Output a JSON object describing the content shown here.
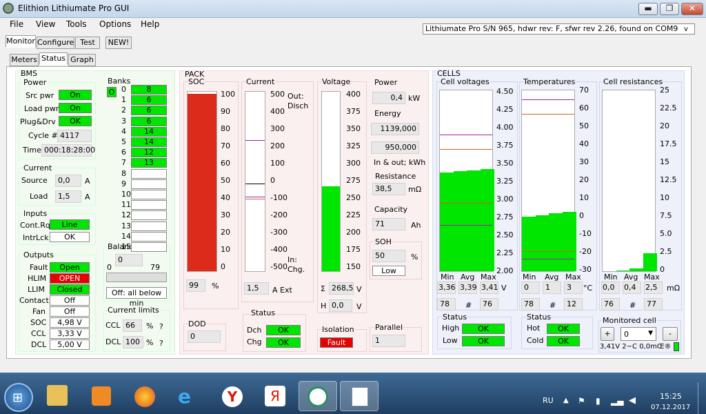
{
  "window": {
    "title": "Elithion Lithiumate Pro GUI",
    "minimize": "▬",
    "maximize": "❐",
    "close": "✕"
  },
  "menu": [
    "File",
    "View",
    "Tools",
    "Options",
    "Help"
  ],
  "device_info": "Lithiumate Pro S/N 965, hdwr rev: F, sfwr rev 2.26, found on COM9",
  "device_info_arrow": "v",
  "main_tabs": [
    "Monitor",
    "Configure",
    "Test",
    "NEW!"
  ],
  "sub_tabs": [
    "Meters",
    "Status",
    "Graph"
  ],
  "colors": {
    "green": "#00e600",
    "red": "#e60000",
    "bms_bg": "#f3fbf1",
    "pack_bg": "#fbf0f0",
    "cells_bg": "#eef0fa"
  },
  "bms": {
    "title": "BMS",
    "power": {
      "title": "Power",
      "src_label": "Src pwr",
      "src": "On",
      "load_label": "Load pwr",
      "load": "On",
      "plug_label": "Plug&Drv",
      "plug": "OK",
      "cycle_label": "Cycle #",
      "cycle": "4117",
      "time_label": "Time",
      "time": "000:18:28:00"
    },
    "current": {
      "title": "Current",
      "source_label": "Source",
      "source": "0,0",
      "source_unit": "A",
      "load_label": "Load",
      "load": "1,5",
      "load_unit": "A"
    },
    "inputs": {
      "title": "Inputs",
      "contrq_label": "Cont.Rq",
      "contrq": "Line",
      "intrlck_label": "IntrLck",
      "intrlck": "OK"
    },
    "outputs": {
      "title": "Outputs",
      "fault_label": "Fault",
      "fault": "Open",
      "hlim_label": "HLIM",
      "hlim": "OPEN",
      "llim_label": "LLIM",
      "llim": "Closed",
      "contact_label": "Contact.",
      "contact": "Off",
      "fan_label": "Fan",
      "fan": "Off",
      "soc_label": "SOC",
      "soc": "4,98 V",
      "ccl_label": "CCL",
      "ccl": "3,33 V",
      "dcl_label": "DCL",
      "dcl": "5,00 V"
    },
    "banks": {
      "title": "Banks",
      "selector": "O",
      "rows": [
        {
          "n": "0",
          "v": "8"
        },
        {
          "n": "1",
          "v": "6"
        },
        {
          "n": "2",
          "v": "6"
        },
        {
          "n": "3",
          "v": "6"
        },
        {
          "n": "4",
          "v": "14"
        },
        {
          "n": "5",
          "v": "14"
        },
        {
          "n": "6",
          "v": "12"
        },
        {
          "n": "7",
          "v": "13"
        },
        {
          "n": "8",
          "v": ""
        },
        {
          "n": "9",
          "v": ""
        },
        {
          "n": "10",
          "v": ""
        },
        {
          "n": "11",
          "v": ""
        },
        {
          "n": "12",
          "v": ""
        },
        {
          "n": "13",
          "v": ""
        },
        {
          "n": "14",
          "v": ""
        },
        {
          "n": "15",
          "v": ""
        }
      ]
    },
    "balance": {
      "title": "Balance loads",
      "value": "0",
      "min": "0",
      "max": "79",
      "progress": 0,
      "status": "Off: all below min"
    },
    "current_limits": {
      "title": "Current limits",
      "ccl_label": "CCL",
      "ccl": "66",
      "ccl_unit": "%",
      "ccl_q": "?",
      "dcl_label": "DCL",
      "dcl": "100",
      "dcl_unit": "%",
      "dcl_q": "?"
    }
  },
  "pack": {
    "title": "PACK",
    "soc": {
      "title": "SOC",
      "ticks": [
        "100",
        "90",
        "80",
        "70",
        "60",
        "50",
        "40",
        "30",
        "20",
        "10",
        "0"
      ],
      "level_percent": 99,
      "value": "99",
      "unit": "%"
    },
    "current": {
      "title": "Current",
      "ticks": [
        "500",
        "400",
        "300",
        "200",
        "100",
        "0",
        "-100",
        "-200",
        "-300",
        "-400",
        "-500"
      ],
      "out_label": "Out:\nDisch",
      "in_label": "In:\nChg.",
      "value": "1,5",
      "unit": "A Ext"
    },
    "voltage": {
      "title": "Voltage",
      "ticks": [
        "400",
        "375",
        "350",
        "325",
        "300",
        "275",
        "250",
        "225",
        "200",
        "175",
        "150"
      ],
      "level_value": 268.5,
      "range": [
        150,
        400
      ],
      "sum_label": "Σ",
      "sum": "268,5",
      "sum_unit": "V",
      "h_label": "H",
      "h": "0,0",
      "h_unit": "V"
    },
    "power": {
      "title": "Power",
      "value": "0,4",
      "unit": "kW"
    },
    "energy": {
      "title": "Energy",
      "in": "1139,000",
      "out": "950,000",
      "caption": "In & out; kWh"
    },
    "resistance": {
      "title": "Resistance",
      "value": "38,5",
      "unit": "mΩ"
    },
    "capacity": {
      "title": "Capacity",
      "value": "71",
      "unit": "Ah"
    },
    "soh": {
      "title": "SOH",
      "value": "50",
      "unit": "%",
      "status": "Low"
    },
    "dod": {
      "title": "DOD",
      "value": "0"
    },
    "status": {
      "title": "Status",
      "dch_label": "Dch",
      "dch": "OK",
      "chg_label": "Chg",
      "chg": "OK"
    },
    "isolation": {
      "title": "Isolation",
      "value": "Fault"
    },
    "parallel": {
      "title": "Parallel",
      "value": "1"
    }
  },
  "cells": {
    "title": "CELLS",
    "voltages": {
      "title": "Cell voltages",
      "ticks": [
        "4.50",
        "4.25",
        "4.00",
        "3.75",
        "3.50",
        "3.25",
        "3.00",
        "2.75",
        "2.50",
        "2.25",
        "2.00"
      ],
      "range": [
        2.0,
        4.5
      ],
      "bars": [
        3.36,
        3.38,
        3.39,
        3.41
      ],
      "min_label": "Min",
      "avg_label": "Avg",
      "max_label": "Max",
      "min": "3,36",
      "avg": "3,39",
      "max": "3,41",
      "unit": "V",
      "min_cell": "78",
      "hash": "#",
      "max_cell": "76"
    },
    "temperatures": {
      "title": "Temperatures",
      "ticks": [
        "70",
        "60",
        "50",
        "40",
        "30",
        "20",
        "10",
        "0",
        "-10",
        "-20",
        "-30"
      ],
      "range": [
        -30,
        70
      ],
      "bars": [
        0,
        1,
        2,
        3
      ],
      "min_label": "Min",
      "avg_label": "Avg",
      "max_label": "Max",
      "min": "0",
      "avg": "1",
      "max": "3",
      "unit": "°C",
      "min_cell": "78",
      "hash": "#",
      "max_cell": "12"
    },
    "resistances": {
      "title": "Cell resistances",
      "ticks": [
        "25",
        "22.5",
        "20",
        "17.5",
        "15",
        "12.5",
        "10",
        "7.5",
        "5.0",
        "2.5",
        "0"
      ],
      "range": [
        0,
        25
      ],
      "bars": [
        0,
        0.1,
        0.4,
        2.5
      ],
      "min_label": "Min",
      "avg_label": "Avg",
      "max_label": "Max",
      "min": "0,0",
      "avg": "0,4",
      "max": "2,5",
      "unit": "mΩ",
      "min_cell": "76",
      "hash": "#",
      "max_cell": "77"
    },
    "vstatus": {
      "title": "Status",
      "high_label": "High",
      "high": "OK",
      "low_label": "Low",
      "low": "OK"
    },
    "tstatus": {
      "title": "Status",
      "hot_label": "Hot",
      "hot": "OK",
      "cold_label": "Cold",
      "cold": "OK"
    },
    "monitored": {
      "title": "Monitored cell",
      "plus": "+",
      "value": "0",
      "minus": "-",
      "readout": "3,41V 2~C 0,0mŒ®"
    }
  },
  "taskbar": {
    "lang": "RU",
    "time": "15:25",
    "date": "07.12.2017"
  }
}
